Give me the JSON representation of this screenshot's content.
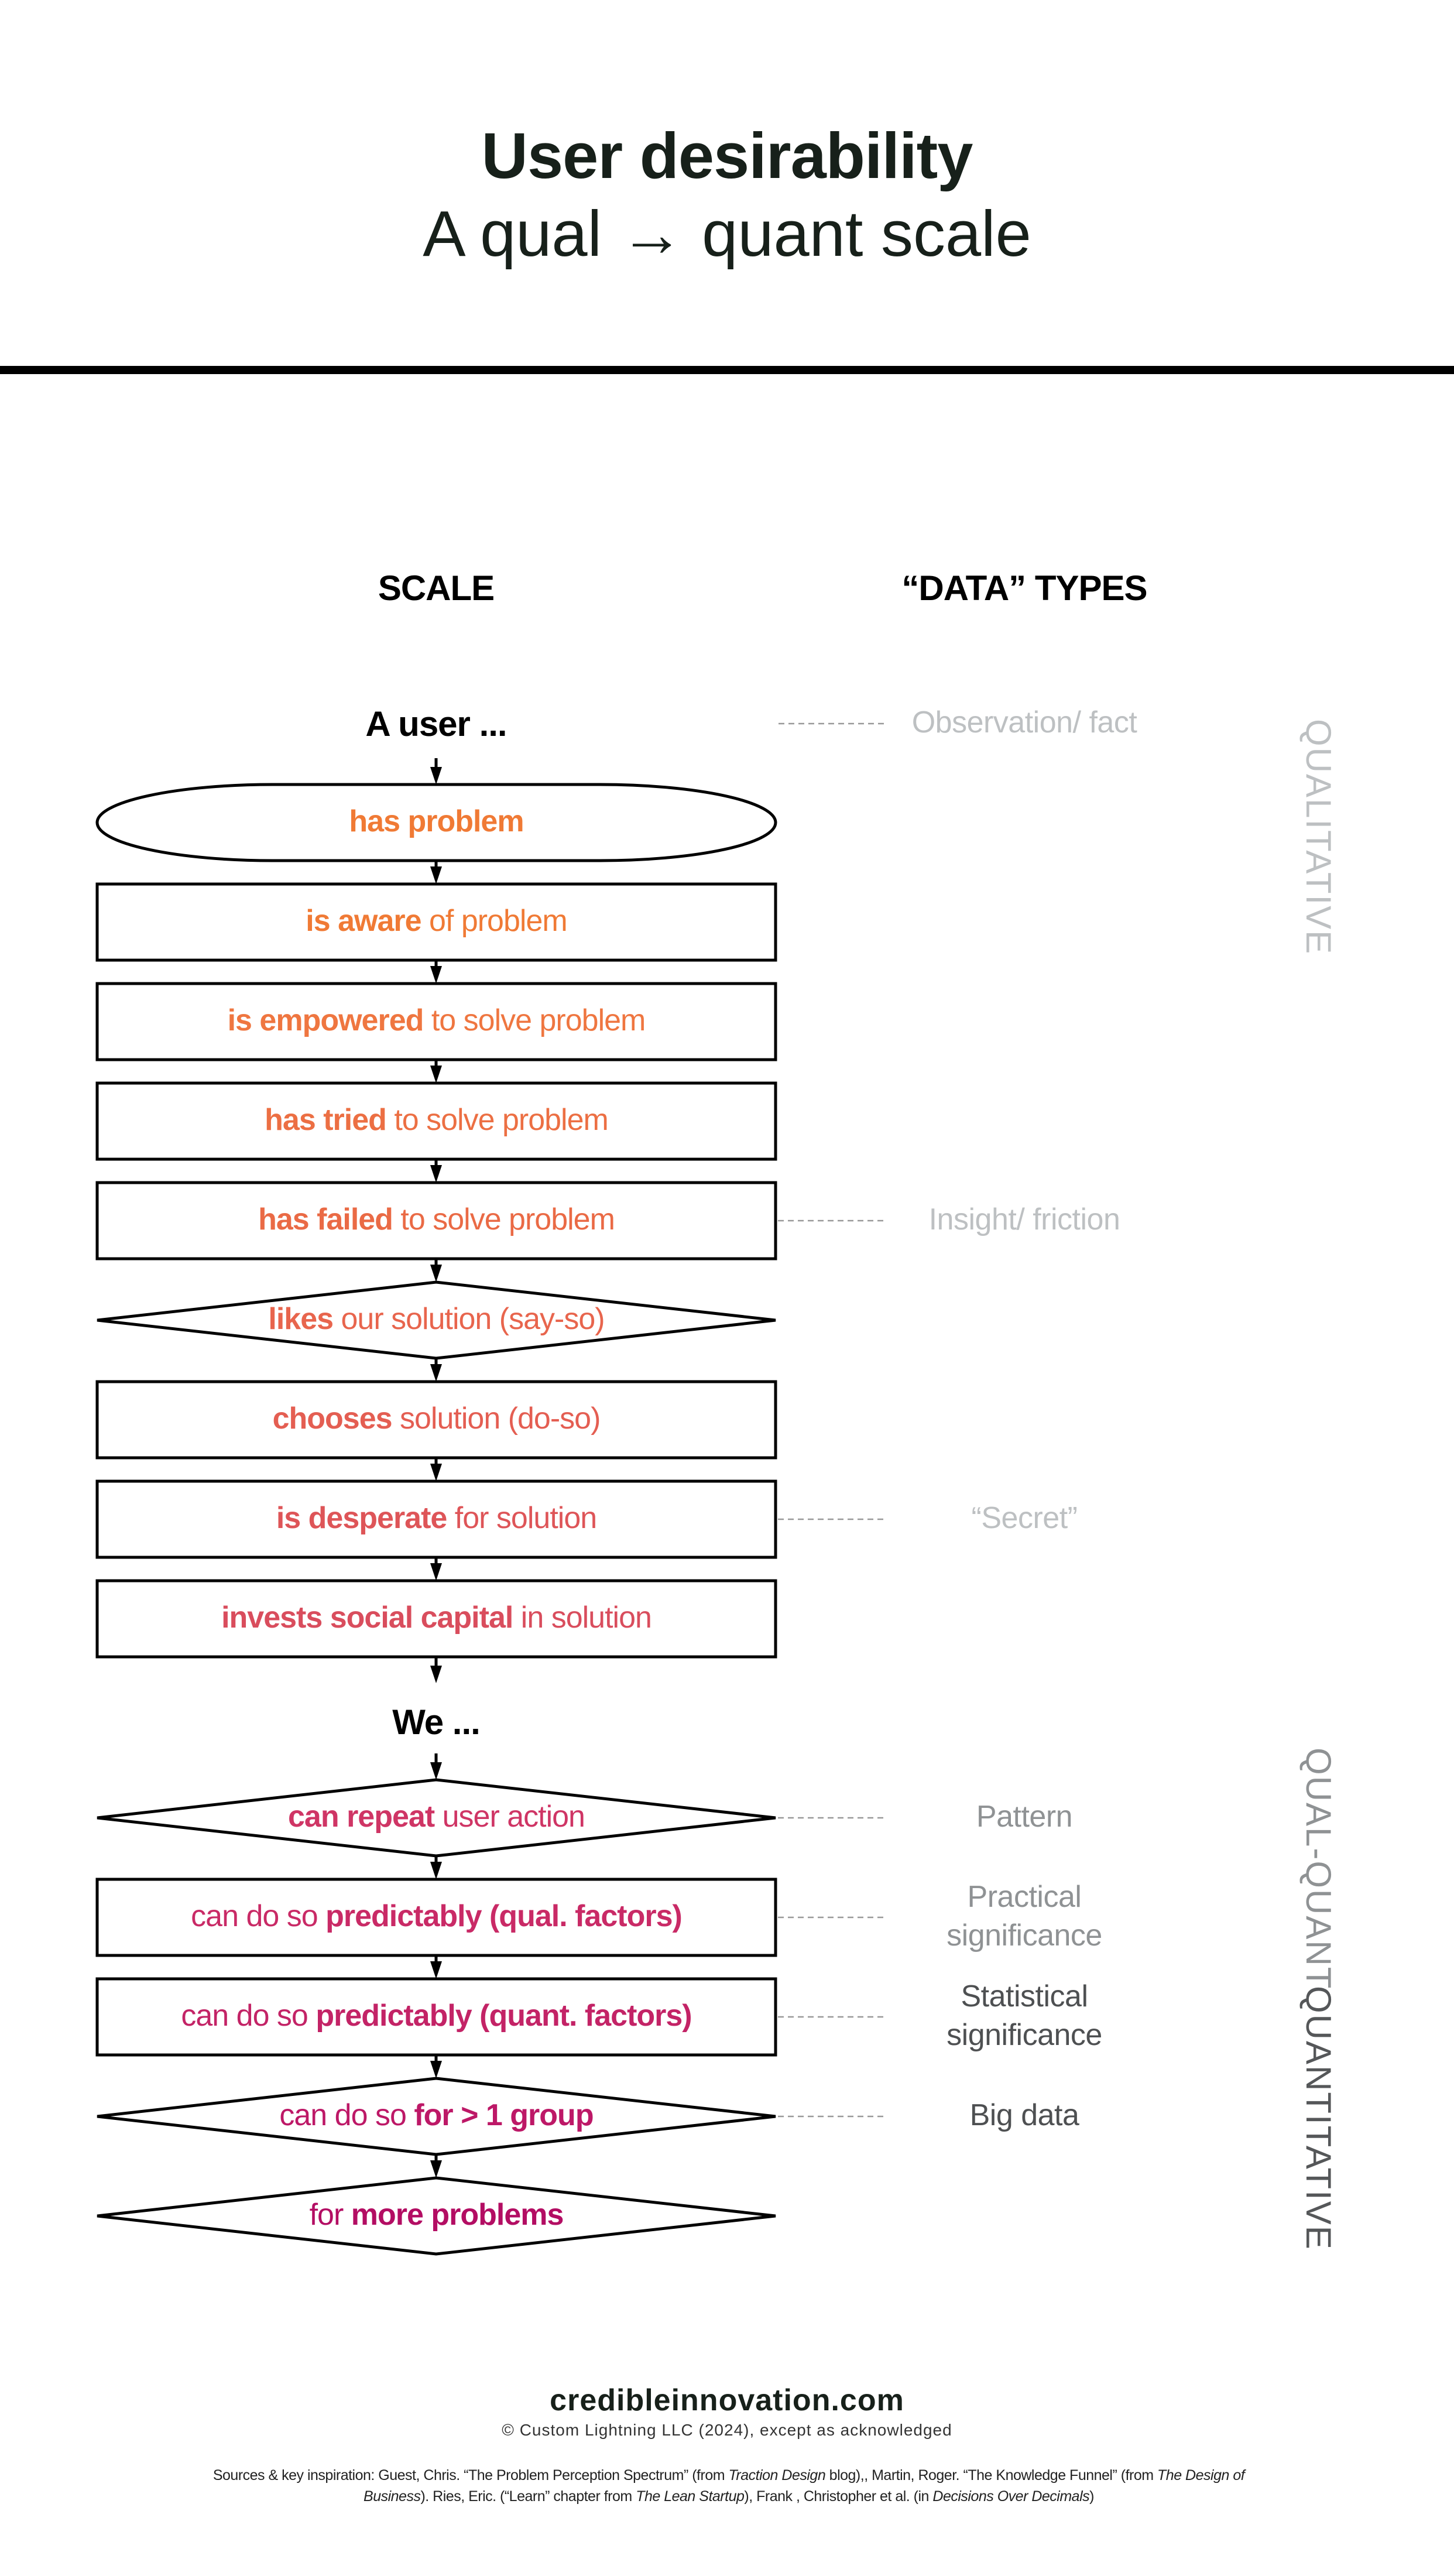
{
  "header": {
    "title": "User desirability",
    "subtitle": "A qual → quant scale"
  },
  "columns": {
    "scale_heading": "SCALE",
    "data_types_heading": "“DATA” TYPES"
  },
  "scale": {
    "lead_user": "A user ...",
    "lead_we": "We ...",
    "steps": [
      {
        "shape": "terminal",
        "bold": "has problem",
        "normal": "",
        "bold_first": true,
        "color": "#f07a35"
      },
      {
        "shape": "process",
        "bold": "is aware",
        "normal": " of problem",
        "bold_first": true,
        "color": "#f07a35"
      },
      {
        "shape": "process",
        "bold": "is empowered",
        "normal": " to solve problem",
        "bold_first": true,
        "color": "#ef7640"
      },
      {
        "shape": "process",
        "bold": "has tried",
        "normal": " to solve problem",
        "bold_first": true,
        "color": "#ec6f43"
      },
      {
        "shape": "process",
        "bold": "has failed",
        "normal": " to solve problem",
        "bold_first": true,
        "color": "#ea6a45"
      },
      {
        "shape": "decision",
        "bold": "likes",
        "normal": " our solution (say-so)",
        "bold_first": true,
        "color": "#e8654d"
      },
      {
        "shape": "process",
        "bold": "chooses",
        "normal": " solution (do-so)",
        "bold_first": true,
        "color": "#e45e52"
      },
      {
        "shape": "process",
        "bold": "is desperate",
        "normal": " for solution",
        "bold_first": true,
        "color": "#de5558"
      },
      {
        "shape": "process",
        "bold": "invests social capital",
        "normal": " in solution",
        "bold_first": true,
        "color": "#d94d5d"
      },
      {
        "shape": "decision",
        "bold": "can repeat",
        "normal": " user action",
        "bold_first": true,
        "color": "#cf3565"
      },
      {
        "shape": "process",
        "bold": "predictably (qual. factors)",
        "normal": "can do so ",
        "bold_first": false,
        "color": "#c92a66"
      },
      {
        "shape": "process",
        "bold": "predictably (quant. factors)",
        "normal": "can do so ",
        "bold_first": false,
        "color": "#c32366"
      },
      {
        "shape": "decision",
        "bold": "for > 1 group",
        "normal": "can do so ",
        "bold_first": false,
        "color": "#bd1867"
      },
      {
        "shape": "decision",
        "bold": "more problems",
        "normal": "for ",
        "bold_first": false,
        "color": "#b30d63"
      }
    ]
  },
  "data_types": [
    {
      "step_index": -1,
      "lines": [
        "Observation/ fact"
      ],
      "color": "#bdc0c2"
    },
    {
      "step_index": 4,
      "lines": [
        "Insight/ friction"
      ],
      "color": "#bdc0c2"
    },
    {
      "step_index": 7,
      "lines": [
        "“Secret”"
      ],
      "color": "#bdc0c2"
    },
    {
      "step_index": 9,
      "lines": [
        "Pattern"
      ],
      "color": "#8f9294"
    },
    {
      "step_index": 10,
      "lines": [
        "Practical",
        "significance"
      ],
      "color": "#8f9294"
    },
    {
      "step_index": 11,
      "lines": [
        "Statistical",
        "significance"
      ],
      "color": "#4e5052"
    },
    {
      "step_index": 12,
      "lines": [
        "Big data"
      ],
      "color": "#4e5052"
    }
  ],
  "categories": [
    {
      "label": "QUALITATIVE",
      "color": "#bdc0c2"
    },
    {
      "label": "QUAL-QUANT",
      "color": "#8f9294"
    },
    {
      "label": "QUANTITATIVE",
      "color": "#555759"
    }
  ],
  "footer": {
    "site": "credibleinnovation.com",
    "copyright": "© Custom Lightning LLC (2024), except as acknowledged",
    "sources_parts": [
      {
        "text": "Sources & key inspiration: Guest, Chris. “The Problem Perception Spectrum” (from ",
        "italic": false
      },
      {
        "text": "Traction Design",
        "italic": true
      },
      {
        "text": " blog),, Martin, Roger. “The Knowledge Funnel” (from ",
        "italic": false
      },
      {
        "text": "The Design of Business",
        "italic": true
      },
      {
        "text": "). Ries, Eric. (“Learn” chapter from ",
        "italic": false
      },
      {
        "text": "The Lean Startup",
        "italic": true
      },
      {
        "text": "), Frank , Christopher et al. (in ",
        "italic": false
      },
      {
        "text": "Decisions Over Decimals",
        "italic": true
      },
      {
        "text": ")",
        "italic": false
      }
    ]
  }
}
